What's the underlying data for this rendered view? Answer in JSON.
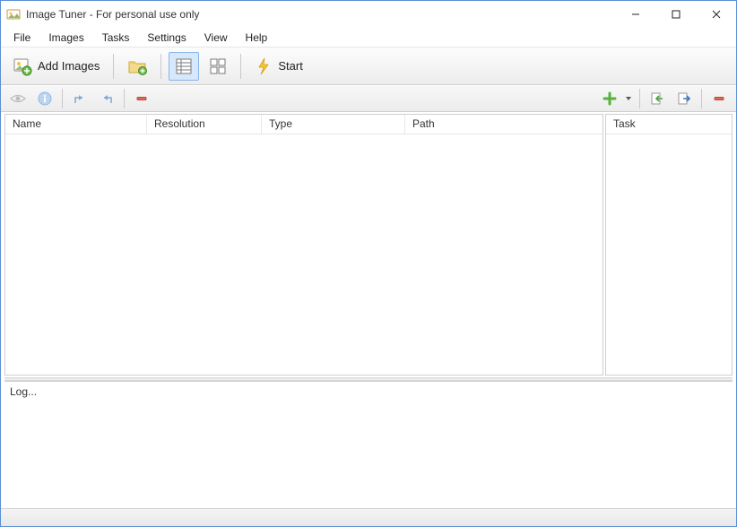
{
  "window": {
    "title": "Image Tuner - For personal use only"
  },
  "menu": {
    "file": "File",
    "images": "Images",
    "tasks": "Tasks",
    "settings": "Settings",
    "view": "View",
    "help": "Help"
  },
  "toolbar": {
    "add_images": "Add Images",
    "start": "Start"
  },
  "columns": {
    "name": "Name",
    "resolution": "Resolution",
    "type": "Type",
    "path": "Path",
    "task": "Task"
  },
  "log": {
    "label": "Log..."
  }
}
